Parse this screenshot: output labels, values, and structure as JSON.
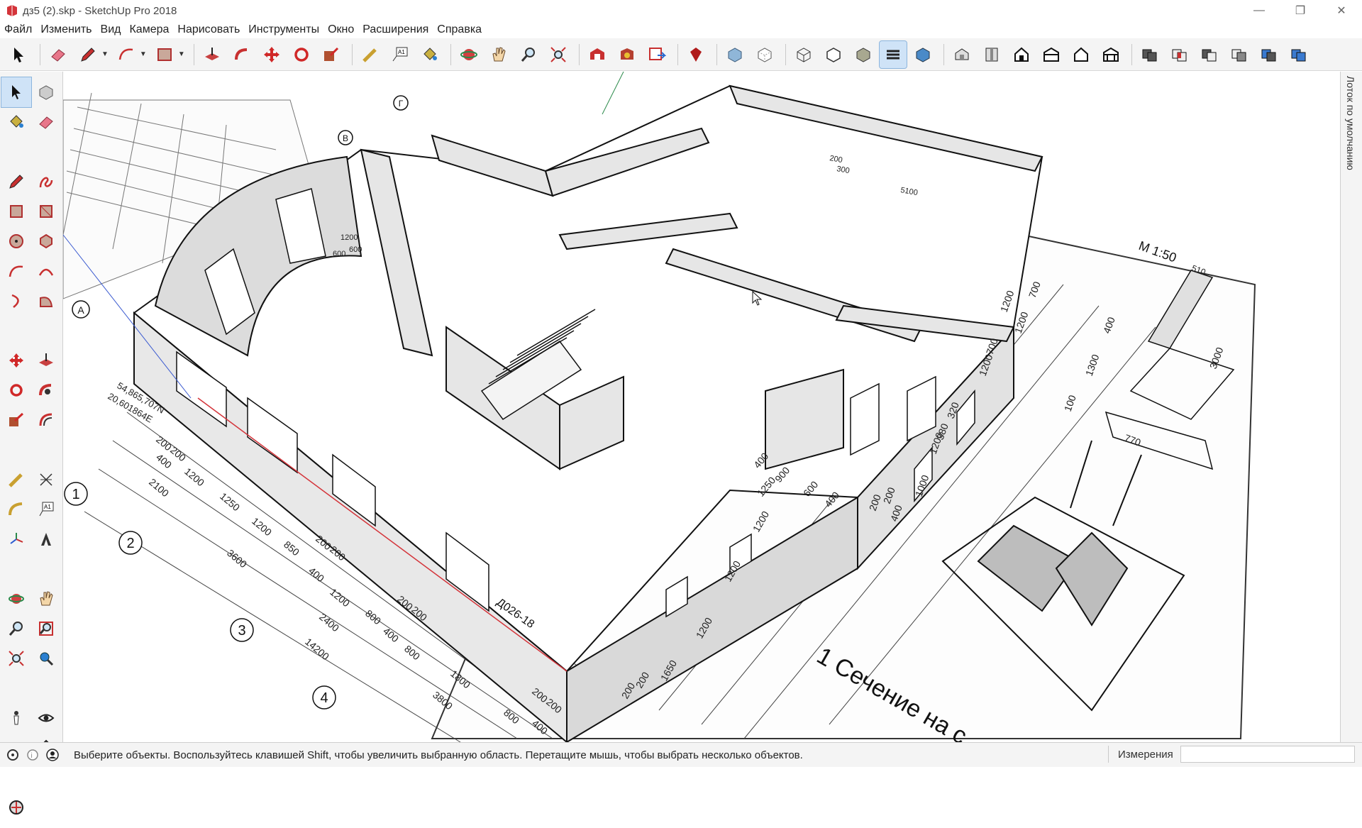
{
  "window": {
    "title": "дз5 (2).skp - SketchUp Pro 2018",
    "controls": [
      "minimize",
      "restore",
      "close"
    ]
  },
  "menu": [
    "Файл",
    "Изменить",
    "Вид",
    "Камера",
    "Нарисовать",
    "Инструменты",
    "Окно",
    "Расширения",
    "Справка"
  ],
  "toolbar": {
    "icons": [
      "select-icon",
      "eraser-icon",
      "pencil-icon",
      "arc-icon",
      "rectangle-icon",
      "push-pull-icon",
      "follow-me-icon",
      "move-icon",
      "rotate-icon",
      "scale-icon",
      "tape-measure-icon",
      "text-icon",
      "paint-bucket-icon",
      "orbit-icon",
      "pan-icon",
      "zoom-icon",
      "zoom-extents-icon",
      "warehouse-icon",
      "extension-warehouse-icon",
      "layout-icon",
      "ruby-icon",
      "xray-icon",
      "back-edges-icon",
      "wireframe-icon",
      "hidden-line-icon",
      "shaded-icon",
      "shaded-textures-icon",
      "monochrome-icon",
      "iso-view-icon",
      "top-view-icon",
      "front-view-icon",
      "right-view-icon",
      "back-view-icon",
      "left-view-icon",
      "union-icon",
      "intersect-icon",
      "subtract-icon",
      "trim-icon",
      "split-icon",
      "outer-shell-icon"
    ],
    "active": "shaded-textures-icon"
  },
  "sidebar": {
    "icons": [
      "select-icon",
      "component-icon",
      "paint-bucket-icon",
      "eraser-icon",
      "pencil-icon",
      "freehand-icon",
      "rectangle-icon",
      "rotated-rectangle-icon",
      "circle-icon",
      "polygon-icon",
      "arc-icon",
      "two-point-arc-icon",
      "three-point-arc-icon",
      "pie-icon",
      "move-icon",
      "push-pull-icon",
      "rotate-icon",
      "follow-me-icon",
      "scale-icon",
      "offset-icon",
      "tape-measure-icon",
      "dimension-icon",
      "protractor-icon",
      "text-icon",
      "axes-icon",
      "3d-text-icon",
      "orbit-icon",
      "pan-icon",
      "zoom-icon",
      "zoom-window-icon",
      "zoom-extents-icon",
      "previous-view-icon",
      "position-camera-icon",
      "look-around-icon",
      "walk-icon",
      "section-plane-icon",
      "geo-location-icon"
    ],
    "active": "select-icon"
  },
  "tray": {
    "label": "Лоток по умолчанию"
  },
  "drawing": {
    "grid_labels": [
      "1",
      "2",
      "3",
      "4",
      "А",
      "В",
      "Г"
    ],
    "scale_label": "М 1:50",
    "section_caption": "1 Сечение на с",
    "door_label": "Д026-18",
    "dims_left": [
      "200",
      "200",
      "400",
      "2100",
      "1200",
      "1250",
      "1200",
      "3600",
      "850",
      "200",
      "200",
      "400",
      "1200",
      "800",
      "2400",
      "200",
      "200",
      "400",
      "800",
      "14200",
      "1800",
      "3800",
      "800",
      "200",
      "200",
      "400"
    ],
    "dims_right": [
      "400",
      "900",
      "1250",
      "600",
      "400",
      "200",
      "200",
      "400",
      "1000",
      "1200",
      "1200",
      "1200",
      "1200",
      "1650",
      "200",
      "200",
      "380",
      "320",
      "1200",
      "700",
      "1200",
      "700",
      "1200",
      "1300",
      "100",
      "3000",
      "400",
      "510",
      "770",
      "5100",
      "200",
      "300"
    ],
    "coords": [
      "54,865,707N",
      "20,601864E"
    ],
    "stair_dims": [
      "1200",
      "600",
      "600"
    ]
  },
  "status": {
    "message": "Выберите объекты. Воспользуйтесь клавишей Shift, чтобы увеличить выбранную область. Перетащите мышь, чтобы выбрать несколько объектов.",
    "measurements_label": "Измерения",
    "measurements_value": ""
  },
  "colors": {
    "accent_red": "#d4343a",
    "chrome_bg": "#f4f4f4",
    "selection_blue": "#cfe3f7"
  }
}
